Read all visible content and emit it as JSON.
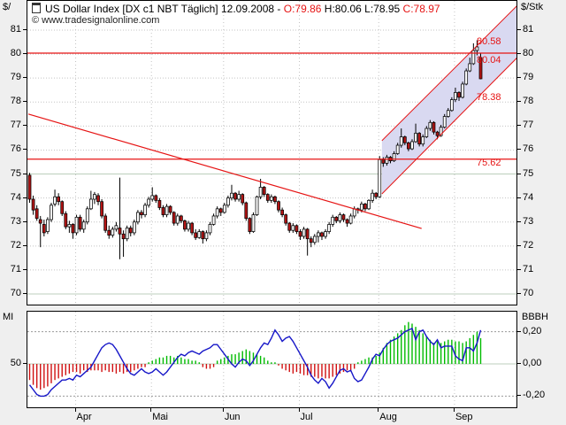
{
  "title": {
    "instrument": "US Dollar Index [DX c1 NBT  Täglich]",
    "date": "12.09.2008",
    "sep": "-",
    "open": "O:79.86",
    "high": "H:80.06",
    "low": "L:78.95",
    "close": "C:78.97"
  },
  "watermark": {
    "mark": "©",
    "url": "www.tradesignalonline.com"
  },
  "axis": {
    "left_unit": "$/",
    "right_unit": "$/Stk",
    "price_ticks": [
      81,
      80,
      79,
      78,
      77,
      76,
      75,
      74,
      73,
      72,
      71,
      70
    ],
    "major_levels": [
      75,
      70
    ],
    "months": [
      {
        "label": "Apr",
        "day": 13
      },
      {
        "label": "Mai",
        "day": 34
      },
      {
        "label": "Jun",
        "day": 54
      },
      {
        "label": "Jul",
        "day": 75
      },
      {
        "label": "Aug",
        "day": 97
      },
      {
        "label": "Sep",
        "day": 118
      }
    ]
  },
  "indicator": {
    "left_label": "MI",
    "left_tick": "50",
    "right_label": "BBBH",
    "right_ticks": [
      {
        "label": "0,20",
        "value": 0.2
      },
      {
        "label": "0,00",
        "value": 0.0
      },
      {
        "label": "-0,20",
        "value": -0.2
      }
    ]
  },
  "annotations": {
    "hlines": [
      80.04,
      75.62
    ],
    "price_labels": [
      "80.58",
      "80.04",
      "78.38",
      "75.62"
    ],
    "trendline": {
      "from_day": 0,
      "from_price": 77.5,
      "to_day": 109,
      "to_price": 72.73
    },
    "channel": {
      "from_day": 98,
      "to_day": 136,
      "lower_from_price": 74.17,
      "lower_to_price": 79.93,
      "upper_from_price": 76.39,
      "upper_to_price": 82.1
    }
  },
  "chart_data": {
    "type": "candlestick",
    "title": "US Dollar Index [DX c1 NBT Täglich]",
    "date": "12.09.2008",
    "interval": "Täglich",
    "last_quote": {
      "open": 79.86,
      "high": 80.06,
      "low": 78.95,
      "close": 78.97
    },
    "ylabel_left": "$/",
    "ylabel_right": "$/Stk",
    "ylim": [
      69.3,
      82.2
    ],
    "x_months": [
      "Apr",
      "Mai",
      "Jun",
      "Jul",
      "Aug",
      "Sep"
    ],
    "ohlc": [
      [
        74.95,
        75.05,
        73.8,
        73.95
      ],
      [
        73.95,
        74.1,
        73.3,
        73.5
      ],
      [
        73.55,
        73.7,
        73.05,
        73.15
      ],
      [
        73.1,
        73.25,
        71.95,
        72.95
      ],
      [
        72.9,
        73.1,
        72.4,
        72.55
      ],
      [
        72.6,
        73.2,
        72.5,
        73.1
      ],
      [
        73.1,
        73.8,
        73.0,
        73.7
      ],
      [
        73.75,
        74.35,
        73.65,
        74.05
      ],
      [
        74.05,
        74.2,
        73.7,
        73.85
      ],
      [
        73.85,
        73.9,
        73.25,
        73.35
      ],
      [
        73.35,
        73.45,
        72.7,
        72.8
      ],
      [
        72.8,
        73.05,
        72.55,
        72.9
      ],
      [
        72.9,
        72.95,
        72.3,
        72.55
      ],
      [
        72.55,
        73.3,
        72.45,
        73.2
      ],
      [
        73.2,
        73.3,
        72.6,
        72.7
      ],
      [
        72.7,
        73.1,
        72.55,
        73.0
      ],
      [
        73.0,
        73.65,
        72.9,
        73.55
      ],
      [
        73.55,
        74.3,
        73.5,
        73.95
      ],
      [
        73.95,
        74.25,
        73.75,
        74.15
      ],
      [
        74.1,
        74.2,
        73.7,
        73.85
      ],
      [
        73.85,
        73.95,
        73.15,
        73.25
      ],
      [
        73.25,
        73.35,
        72.55,
        72.65
      ],
      [
        72.65,
        72.85,
        72.3,
        72.45
      ],
      [
        72.45,
        72.8,
        72.35,
        72.7
      ],
      [
        72.7,
        73.0,
        72.6,
        72.85
      ],
      [
        72.75,
        74.85,
        71.45,
        72.5
      ],
      [
        72.5,
        72.65,
        71.55,
        72.3
      ],
      [
        72.3,
        72.85,
        72.2,
        72.75
      ],
      [
        72.75,
        72.85,
        72.4,
        72.55
      ],
      [
        72.55,
        73.1,
        72.45,
        73.0
      ],
      [
        73.0,
        73.5,
        72.9,
        73.4
      ],
      [
        73.4,
        73.5,
        73.15,
        73.3
      ],
      [
        73.3,
        73.8,
        73.2,
        73.7
      ],
      [
        73.7,
        74.05,
        73.6,
        73.95
      ],
      [
        73.95,
        74.45,
        73.85,
        74.1
      ],
      [
        74.1,
        74.15,
        73.8,
        73.9
      ],
      [
        73.9,
        74.0,
        73.5,
        73.6
      ],
      [
        73.6,
        73.7,
        73.2,
        73.3
      ],
      [
        73.3,
        73.75,
        73.2,
        73.65
      ],
      [
        73.65,
        73.7,
        73.3,
        73.4
      ],
      [
        73.4,
        73.45,
        72.85,
        72.95
      ],
      [
        72.95,
        73.35,
        72.85,
        73.25
      ],
      [
        73.25,
        73.3,
        72.95,
        73.05
      ],
      [
        73.05,
        73.1,
        72.6,
        72.7
      ],
      [
        72.7,
        73.05,
        72.6,
        72.95
      ],
      [
        72.95,
        73.0,
        72.45,
        72.55
      ],
      [
        72.55,
        72.7,
        72.25,
        72.35
      ],
      [
        72.35,
        72.7,
        72.3,
        72.6
      ],
      [
        72.6,
        72.65,
        72.1,
        72.3
      ],
      [
        72.3,
        72.65,
        72.2,
        72.55
      ],
      [
        72.55,
        73.0,
        72.45,
        72.9
      ],
      [
        72.9,
        73.35,
        72.85,
        73.25
      ],
      [
        73.25,
        73.65,
        73.15,
        73.55
      ],
      [
        73.55,
        73.6,
        73.25,
        73.4
      ],
      [
        73.4,
        73.8,
        73.35,
        73.7
      ],
      [
        73.7,
        74.1,
        73.6,
        74.0
      ],
      [
        74.0,
        74.55,
        73.9,
        74.2
      ],
      [
        74.2,
        74.25,
        73.85,
        73.95
      ],
      [
        73.95,
        74.3,
        73.85,
        74.15
      ],
      [
        74.15,
        74.2,
        73.7,
        73.8
      ],
      [
        73.8,
        73.85,
        73.05,
        73.15
      ],
      [
        73.15,
        73.2,
        72.5,
        72.6
      ],
      [
        72.6,
        73.4,
        72.55,
        73.3
      ],
      [
        73.3,
        74.1,
        73.25,
        74.05
      ],
      [
        74.05,
        74.8,
        73.95,
        74.45
      ],
      [
        74.45,
        74.5,
        74.05,
        74.15
      ],
      [
        74.15,
        74.2,
        73.8,
        73.9
      ],
      [
        73.9,
        74.15,
        73.8,
        74.05
      ],
      [
        74.05,
        74.1,
        73.75,
        73.85
      ],
      [
        73.85,
        73.9,
        73.4,
        73.5
      ],
      [
        73.5,
        73.6,
        73.2,
        73.3
      ],
      [
        73.3,
        73.35,
        72.85,
        72.95
      ],
      [
        72.95,
        73.0,
        72.55,
        72.65
      ],
      [
        72.65,
        72.95,
        72.55,
        72.85
      ],
      [
        72.85,
        72.9,
        72.5,
        72.6
      ],
      [
        72.6,
        72.7,
        72.25,
        72.4
      ],
      [
        72.4,
        72.8,
        72.3,
        72.7
      ],
      [
        72.7,
        72.75,
        71.6,
        72.3
      ],
      [
        72.3,
        72.4,
        71.95,
        72.15
      ],
      [
        72.15,
        72.5,
        72.05,
        72.4
      ],
      [
        72.4,
        72.65,
        72.15,
        72.55
      ],
      [
        72.55,
        72.6,
        72.25,
        72.4
      ],
      [
        72.4,
        72.7,
        72.3,
        72.6
      ],
      [
        72.6,
        73.0,
        72.5,
        72.9
      ],
      [
        72.9,
        73.3,
        72.8,
        73.2
      ],
      [
        73.2,
        73.25,
        72.95,
        73.05
      ],
      [
        73.05,
        73.4,
        72.95,
        73.3
      ],
      [
        73.3,
        73.35,
        73.0,
        73.1
      ],
      [
        73.1,
        73.15,
        72.8,
        72.95
      ],
      [
        72.95,
        73.35,
        72.9,
        73.25
      ],
      [
        73.25,
        73.65,
        73.15,
        73.55
      ],
      [
        73.55,
        73.6,
        73.35,
        73.5
      ],
      [
        73.5,
        73.85,
        73.4,
        73.75
      ],
      [
        73.75,
        73.8,
        73.45,
        73.55
      ],
      [
        73.55,
        73.95,
        73.5,
        73.9
      ],
      [
        73.9,
        74.35,
        73.8,
        74.2
      ],
      [
        74.2,
        74.25,
        73.95,
        74.05
      ],
      [
        74.05,
        75.75,
        74.0,
        75.6
      ],
      [
        75.6,
        75.7,
        75.3,
        75.45
      ],
      [
        75.45,
        75.8,
        75.35,
        75.7
      ],
      [
        75.7,
        75.75,
        75.45,
        75.55
      ],
      [
        75.55,
        75.95,
        75.5,
        75.85
      ],
      [
        75.85,
        76.3,
        75.8,
        76.2
      ],
      [
        76.2,
        76.9,
        76.1,
        76.55
      ],
      [
        76.55,
        76.6,
        76.2,
        76.3
      ],
      [
        76.3,
        76.35,
        75.95,
        76.05
      ],
      [
        76.05,
        76.45,
        76.0,
        76.35
      ],
      [
        76.35,
        77.1,
        76.3,
        76.7
      ],
      [
        76.7,
        76.75,
        76.15,
        76.25
      ],
      [
        76.25,
        76.65,
        76.15,
        76.55
      ],
      [
        76.55,
        77.0,
        76.5,
        76.9
      ],
      [
        76.9,
        77.25,
        76.8,
        77.15
      ],
      [
        77.15,
        77.2,
        76.65,
        76.75
      ],
      [
        76.75,
        76.8,
        76.45,
        76.6
      ],
      [
        76.6,
        77.05,
        76.55,
        76.95
      ],
      [
        76.95,
        77.5,
        76.9,
        77.4
      ],
      [
        77.4,
        77.75,
        77.35,
        77.65
      ],
      [
        77.65,
        78.2,
        77.6,
        78.1
      ],
      [
        78.1,
        78.6,
        78.0,
        78.4
      ],
      [
        78.4,
        78.45,
        78.05,
        78.2
      ],
      [
        78.2,
        78.85,
        78.15,
        78.75
      ],
      [
        78.75,
        79.4,
        78.7,
        79.3
      ],
      [
        79.3,
        79.85,
        79.25,
        79.6
      ],
      [
        79.6,
        80.45,
        79.55,
        80.15
      ],
      [
        80.15,
        80.58,
        79.95,
        80.3
      ],
      [
        79.86,
        80.06,
        78.95,
        78.97
      ]
    ],
    "indicators": {
      "mi_center_label": "50",
      "mi": [
        -0.13,
        -0.16,
        -0.19,
        -0.2,
        -0.2,
        -0.19,
        -0.16,
        -0.14,
        -0.12,
        -0.1,
        -0.1,
        -0.09,
        -0.1,
        -0.07,
        -0.08,
        -0.06,
        -0.04,
        -0.02,
        0.02,
        0.06,
        0.1,
        0.12,
        0.13,
        0.12,
        0.09,
        0.05,
        0.01,
        -0.03,
        -0.06,
        -0.07,
        -0.05,
        -0.03,
        -0.05,
        -0.06,
        -0.05,
        -0.03,
        -0.05,
        -0.07,
        -0.05,
        -0.02,
        0.01,
        0.04,
        0.06,
        0.05,
        0.07,
        0.08,
        0.07,
        0.06,
        0.08,
        0.09,
        0.1,
        0.12,
        0.12,
        0.09,
        0.06,
        0.03,
        0.0,
        -0.02,
        0.01,
        0.03,
        0.02,
        -0.01,
        0.02,
        0.06,
        0.1,
        0.13,
        0.12,
        0.16,
        0.21,
        0.18,
        0.14,
        0.16,
        0.17,
        0.14,
        0.1,
        0.06,
        0.02,
        -0.02,
        -0.07,
        -0.1,
        -0.12,
        -0.09,
        -0.11,
        -0.15,
        -0.12,
        -0.08,
        -0.04,
        -0.03,
        -0.05,
        -0.04,
        -0.09,
        -0.11,
        -0.1,
        -0.06,
        -0.02,
        0.03,
        0.06,
        0.05,
        0.09,
        0.12,
        0.14,
        0.15,
        0.16,
        0.18,
        0.2,
        0.21,
        0.22,
        0.15,
        0.2,
        0.21,
        0.17,
        0.14,
        0.12,
        0.15,
        0.1,
        0.11,
        0.11,
        0.11,
        0.05,
        0.03,
        0.02,
        0.1,
        0.1,
        0.08,
        0.13,
        0.21
      ],
      "bbbh": [
        -0.1,
        -0.13,
        -0.15,
        -0.16,
        -0.15,
        -0.14,
        -0.12,
        -0.1,
        -0.09,
        -0.08,
        -0.07,
        -0.06,
        -0.05,
        -0.05,
        -0.06,
        -0.04,
        -0.05,
        -0.04,
        -0.04,
        -0.04,
        -0.05,
        -0.04,
        -0.05,
        -0.05,
        -0.06,
        -0.05,
        -0.06,
        -0.05,
        -0.05,
        -0.04,
        -0.03,
        -0.02,
        -0.02,
        0.01,
        0.02,
        0.03,
        0.04,
        0.04,
        0.05,
        0.05,
        0.04,
        0.05,
        0.04,
        0.03,
        0.03,
        0.02,
        0.02,
        0.01,
        -0.02,
        -0.03,
        -0.03,
        -0.02,
        0.02,
        0.03,
        0.04,
        0.05,
        0.06,
        0.06,
        0.07,
        0.08,
        0.09,
        0.08,
        0.07,
        0.06,
        0.05,
        0.04,
        0.02,
        0.01,
        0.01,
        -0.01,
        -0.03,
        -0.04,
        -0.05,
        -0.06,
        -0.05,
        -0.06,
        -0.07,
        -0.07,
        -0.08,
        -0.08,
        -0.09,
        -0.08,
        -0.09,
        -0.09,
        -0.08,
        -0.07,
        -0.06,
        -0.05,
        -0.04,
        -0.04,
        -0.03,
        0.01,
        0.02,
        0.03,
        0.04,
        0.04,
        0.05,
        0.07,
        0.1,
        0.13,
        0.15,
        0.17,
        0.19,
        0.21,
        0.24,
        0.26,
        0.25,
        0.23,
        0.21,
        0.19,
        0.17,
        0.15,
        0.13,
        0.14,
        0.13,
        0.14,
        0.15,
        0.15,
        0.14,
        0.14,
        0.13,
        0.14,
        0.16,
        0.18,
        0.2,
        0.16
      ]
    }
  },
  "colors": {
    "up_body": "#ffffff",
    "down_body": "#b41414",
    "wick": "#000000",
    "annotation_red": "#e61414",
    "grid_dotted": "#c3c3c3",
    "grid_major": "#bccfbc",
    "channel_fill": "#d9d9f1",
    "mi_line": "#1616c8",
    "hist_up": "#00bb00",
    "hist_down": "#d01010",
    "panel_bg": "#ffffff",
    "page_bg": "#efefef"
  }
}
